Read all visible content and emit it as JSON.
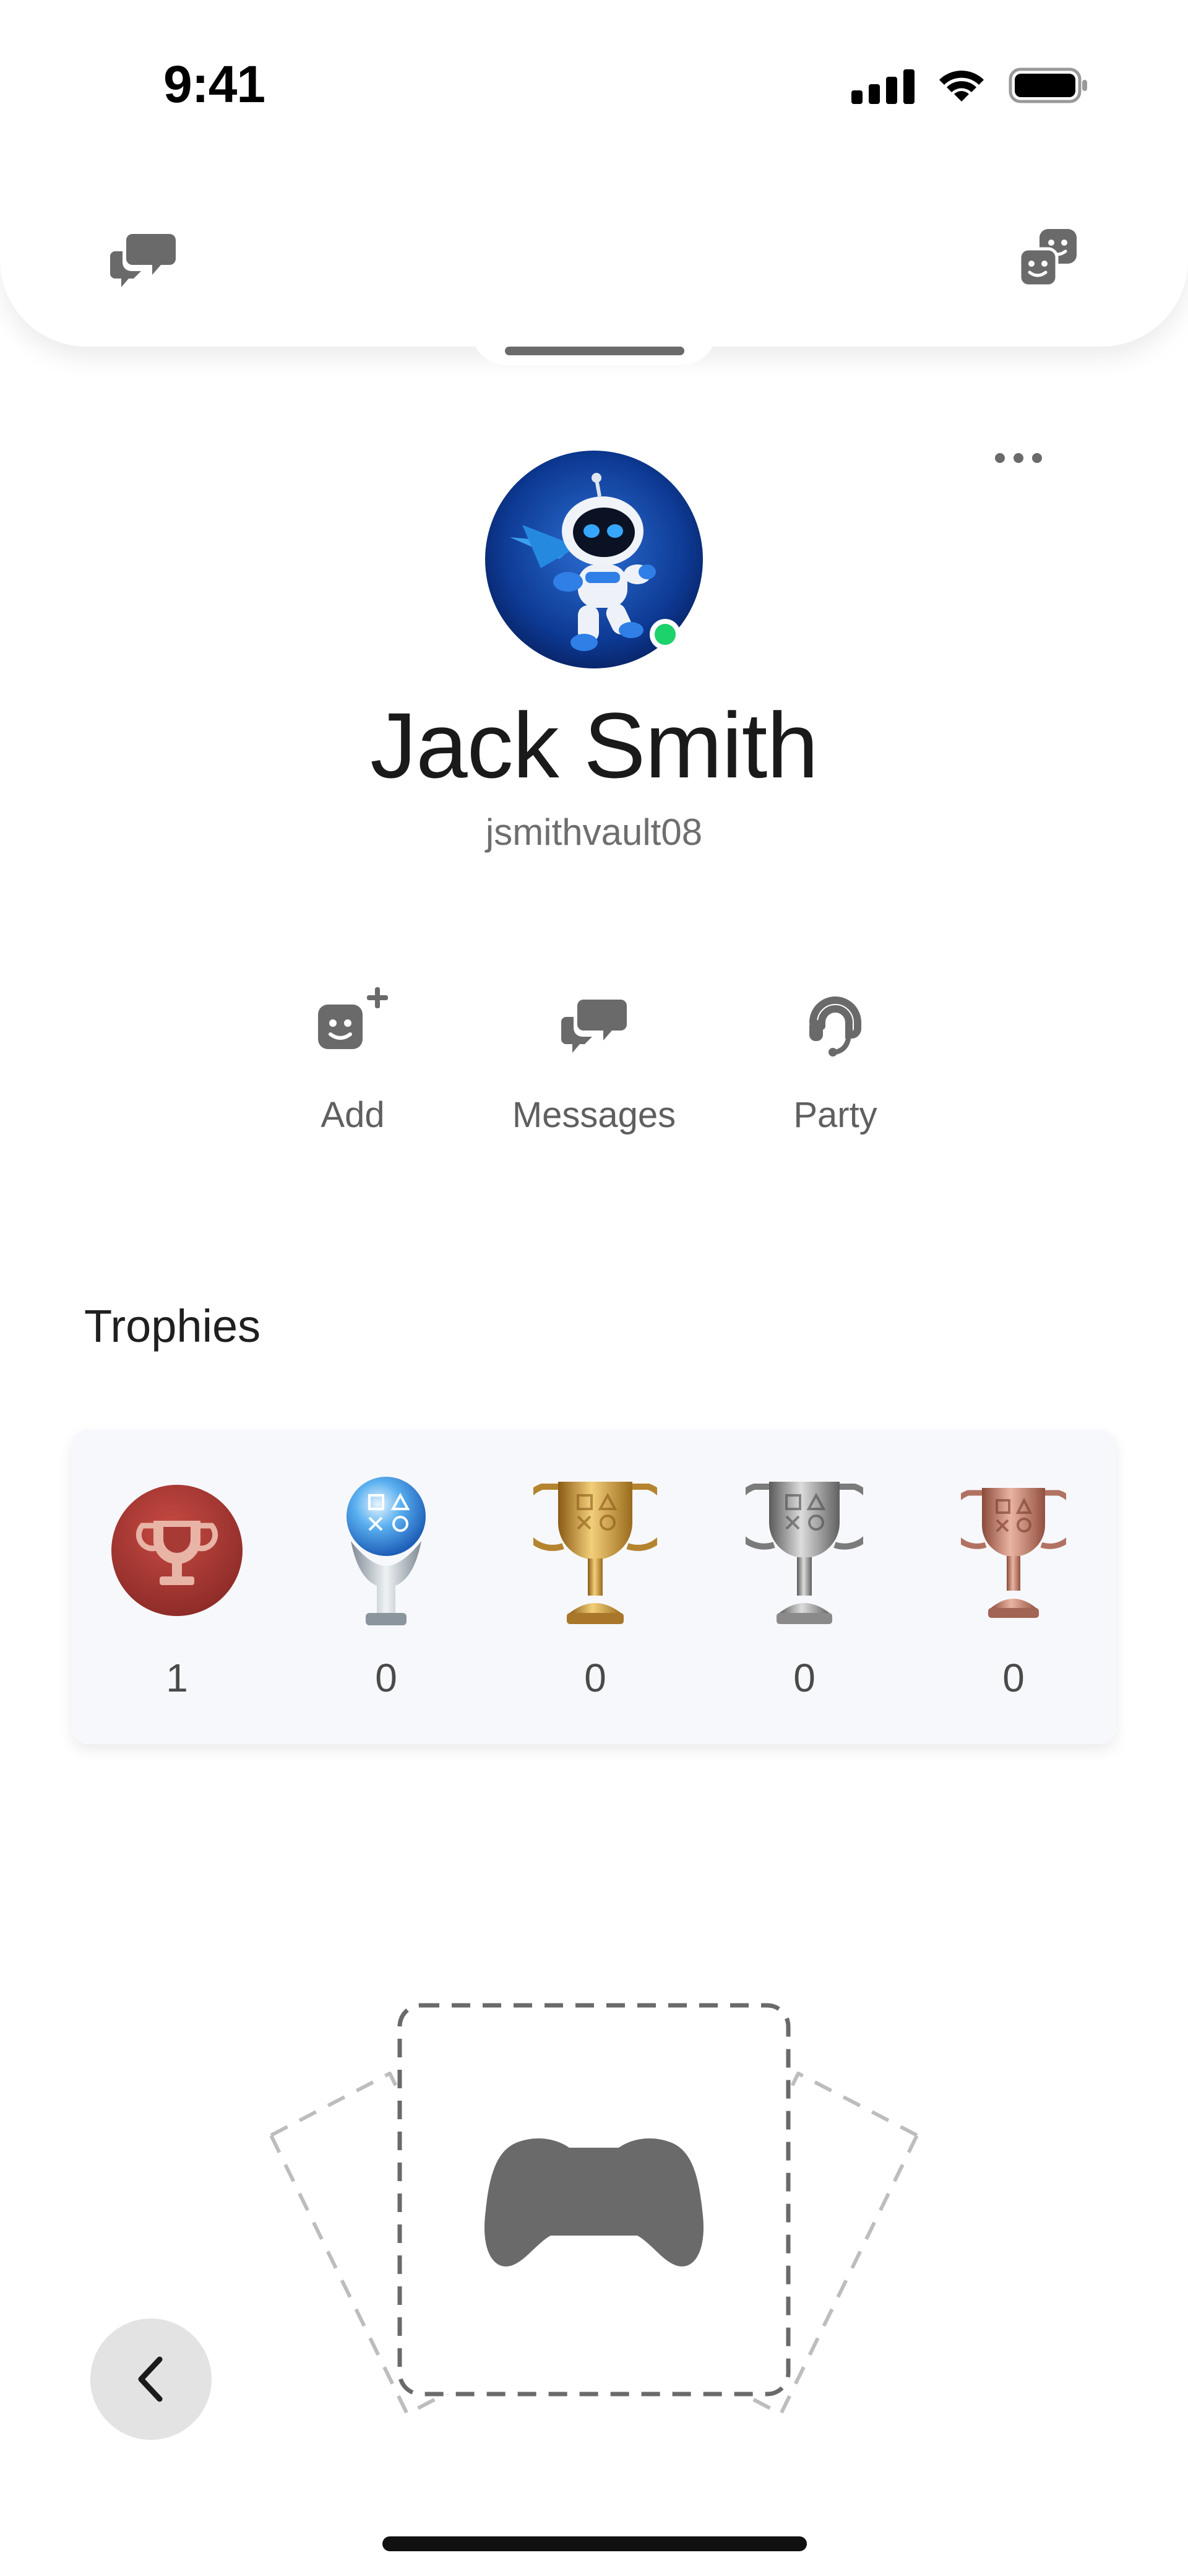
{
  "status_bar": {
    "time": "9:41"
  },
  "profile": {
    "name": "Jack Smith",
    "online_id": "jsmithvault08",
    "online_status_color": "#1dd16b",
    "avatar_icon": "astro-bot-avatar"
  },
  "actions": [
    {
      "label": "Add",
      "icon": "add-friend-icon"
    },
    {
      "label": "Messages",
      "icon": "messages-icon"
    },
    {
      "label": "Party",
      "icon": "party-headset-icon"
    }
  ],
  "trophies": {
    "title": "Trophies",
    "items": [
      {
        "type": "trophy-level",
        "count": "1",
        "color": "#a83a36"
      },
      {
        "type": "platinum",
        "count": "0",
        "color": "#5aa4e8"
      },
      {
        "type": "gold",
        "count": "0",
        "color": "#c99a3b"
      },
      {
        "type": "silver",
        "count": "0",
        "color": "#9a9a9a"
      },
      {
        "type": "bronze",
        "count": "0",
        "color": "#c47a67"
      }
    ]
  },
  "empty_games": {
    "icon": "gamepad-icon"
  },
  "colors": {
    "icon_gray": "#6a6a6a",
    "text_gray": "#5f5f5f"
  }
}
